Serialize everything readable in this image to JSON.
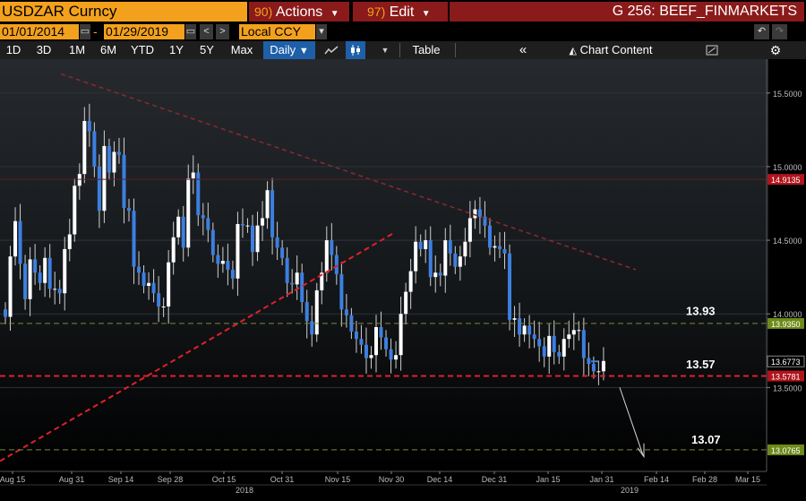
{
  "header": {
    "ticker": "USDZAR Curncy",
    "actions_num": "90",
    "actions_label": "Actions",
    "edit_num": "97",
    "edit_label": "Edit",
    "title": "G 256: BEEF_FINMARKETS"
  },
  "datebar": {
    "start_date": "01/01/2014",
    "end_date": "01/29/2019",
    "currency": "Local CCY"
  },
  "toolbar": {
    "periods": [
      "1D",
      "3D",
      "1M",
      "6M",
      "YTD",
      "1Y",
      "5Y",
      "Max"
    ],
    "frequency": "Daily",
    "table_label": "Table",
    "chart_content_label": "Chart Content"
  },
  "chart_data": {
    "type": "candlestick",
    "ylim": [
      12.93,
      15.73
    ],
    "y_ticks": [
      "15.5000",
      "15.0000",
      "14.5000",
      "14.0000",
      "13.5000"
    ],
    "x_ticks": [
      "Aug 15",
      "Aug 31",
      "Sep 14",
      "Sep 28",
      "Oct 15",
      "Oct 31",
      "Nov 15",
      "Nov 30",
      "Dec 14",
      "Dec 31",
      "Jan 15",
      "Jan 31",
      "Feb 14",
      "Feb 28",
      "Mar 15"
    ],
    "x_years": [
      "2018",
      "2019"
    ],
    "levels": {
      "upper_red": "14.9135",
      "green_upper": "13.9350",
      "last_price": "13.6773",
      "red_lower": "13.5781",
      "green_lower": "13.0765"
    },
    "annotations": [
      "13.93",
      "13.57",
      "13.07"
    ],
    "up_color": "#ffffff",
    "down_color": "#3d7fe0",
    "closes": [
      13.98,
      14.39,
      14.63,
      14.34,
      14.1,
      14.37,
      14.28,
      14.21,
      14.38,
      14.17,
      14.17,
      14.14,
      14.44,
      14.54,
      14.87,
      14.95,
      15.31,
      15.24,
      15.0,
      14.7,
      15.14,
      14.96,
      15.1,
      15.08,
      14.72,
      14.7,
      14.32,
      14.28,
      14.19,
      14.21,
      14.14,
      14.05,
      14.05,
      14.35,
      14.52,
      14.66,
      14.45,
      14.92,
      14.96,
      14.67,
      14.65,
      14.57,
      14.4,
      14.34,
      14.36,
      14.3,
      14.24,
      14.61,
      14.6,
      14.6,
      14.42,
      14.6,
      14.65,
      14.84,
      14.52,
      14.45,
      14.38,
      14.21,
      14.2,
      14.28,
      14.08,
      13.95,
      13.86,
      14.16,
      14.28,
      14.5,
      14.4,
      14.27,
      14.03,
      13.99,
      13.88,
      13.83,
      13.79,
      13.7,
      13.72,
      13.91,
      13.84,
      13.76,
      13.69,
      13.72,
      14.0,
      14.15,
      14.29,
      14.49,
      14.44,
      14.5,
      14.25,
      14.28,
      14.26,
      14.5,
      14.41,
      14.32,
      14.39,
      14.49,
      14.65,
      14.71,
      14.66,
      14.6,
      14.45,
      14.46,
      14.44,
      14.41,
      13.96,
      13.97,
      13.86,
      13.92,
      13.86,
      13.83,
      13.78,
      13.71,
      13.85,
      13.74,
      13.71,
      13.83,
      13.86,
      13.89,
      13.89,
      13.7,
      13.66,
      13.61,
      13.61,
      13.68
    ]
  }
}
